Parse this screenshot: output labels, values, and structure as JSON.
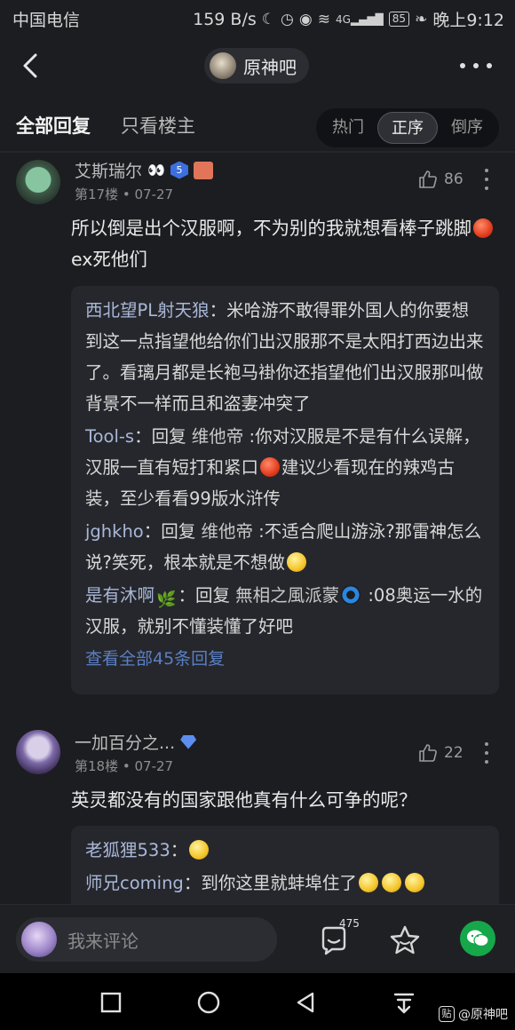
{
  "status_bar": {
    "carrier": "中国电信",
    "net_speed": "159 B/s",
    "battery": "85",
    "time": "晚上9:12",
    "net_type": "4G"
  },
  "nav": {
    "forum_name": "原神吧"
  },
  "filters": {
    "all_replies": "全部回复",
    "op_only": "只看楼主",
    "sort_hot": "热门",
    "sort_asc": "正序",
    "sort_desc": "倒序"
  },
  "posts": [
    {
      "username": "艾斯瑞尔",
      "level": "5",
      "floor": "第17楼",
      "date": "07-27",
      "likes": "86",
      "content_a": "所以倒是出个汉服啊，不为别的我就想看棒子跳脚",
      "content_b": "ex死他们",
      "replies": [
        {
          "name": "西北望PL射天狼",
          "text_a": "：米哈游不敢得罪外国人的你要想到这一点指望他给你们出汉服那不是太阳打西边出来了。看璃月都是长袍马褂你还指望他们出汉服那叫做背景不一样而且和盗妻冲突了"
        },
        {
          "name": "Tool-s",
          "text_a": "：回复 ",
          "target": "维他帝",
          "text_b": " :你对汉服是不是有什么误解，汉服一直有短打和紧口",
          "text_c": "建议少看现在的辣鸡古装，至少看看99版水浒传"
        },
        {
          "name": "jghkho",
          "text_a": "：回复 ",
          "target": "维他帝",
          "text_b": " :不适合爬山游泳?那雷神怎么说?笑死，根本就是不想做"
        },
        {
          "name": "是有沐啊",
          "text_a": "：回复 ",
          "target": "無相之風派蒙",
          "text_b": " :08奥运一水的汉服，就别不懂装懂了好吧"
        }
      ],
      "view_all": "查看全部45条回复"
    },
    {
      "username": "一加百分之...",
      "floor": "第18楼",
      "date": "07-27",
      "likes": "22",
      "content_a": "英灵都没有的国家跟他真有什么可争的呢？",
      "replies": [
        {
          "name": "老狐狸533",
          "text_a": "："
        },
        {
          "name": "师兄coming",
          "text_a": "：到你这里就蚌埠住了"
        }
      ]
    }
  ],
  "bottom_bar": {
    "placeholder": "我来评论",
    "comment_count": "475"
  },
  "watermark": {
    "text": "@原神吧",
    "logo": "贴"
  },
  "icons": [
    "back-icon",
    "more-icon",
    "like-icon",
    "comment-icon",
    "star-icon",
    "wechat-icon",
    "square-nav-icon",
    "circle-nav-icon",
    "triangle-nav-icon",
    "download-nav-icon"
  ]
}
